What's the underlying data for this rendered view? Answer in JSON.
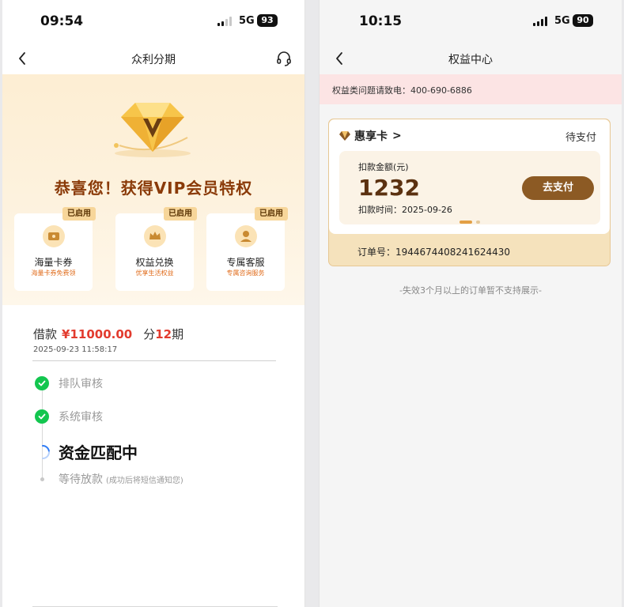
{
  "left": {
    "status": {
      "time": "09:54",
      "network": "5G",
      "battery": "93"
    },
    "nav": {
      "title": "众利分期"
    },
    "hero": {
      "congrats": "恭喜您！获得VIP会员特权"
    },
    "benefits": [
      {
        "badge": "已启用",
        "name": "海量卡券",
        "sub": "海量卡券免费领",
        "icon": "ticket-icon"
      },
      {
        "badge": "已启用",
        "name": "权益兑换",
        "sub": "优享生活权益",
        "icon": "crown-icon"
      },
      {
        "badge": "已启用",
        "name": "专属客服",
        "sub": "专属咨询服务",
        "icon": "service-agent-icon"
      }
    ],
    "loan": {
      "prefix": "借款",
      "amount": "¥11000.00",
      "period_pre": "分",
      "period_num": "12",
      "period_post": "期",
      "time": "2025-09-23 11:58:17"
    },
    "steps": [
      {
        "label": "排队审核",
        "state": "done"
      },
      {
        "label": "系统审核",
        "state": "done"
      },
      {
        "label": "资金匹配中",
        "state": "active"
      },
      {
        "label": "等待放款",
        "note": "(成功后将短信通知您)",
        "state": "pending"
      }
    ]
  },
  "right": {
    "status": {
      "time": "10:15",
      "network": "5G",
      "battery": "90"
    },
    "nav": {
      "title": "权益中心"
    },
    "notice": "权益类问题请致电：400-690-6886",
    "card": {
      "name": "惠享卡",
      "chevron": ">",
      "status": "待支付",
      "amount_label": "扣款金额(元)",
      "amount": "1232",
      "time": "扣款时间：2025-09-26",
      "pay_button": "去支付",
      "order": "订单号：1944674408241624430"
    },
    "footnote": "-失效3个月以上的订单暂不支持展示-"
  },
  "colors": {
    "accent": "#8c5a24",
    "danger": "#e23b2e",
    "success": "#13c64f",
    "gold": "#e3a045"
  }
}
